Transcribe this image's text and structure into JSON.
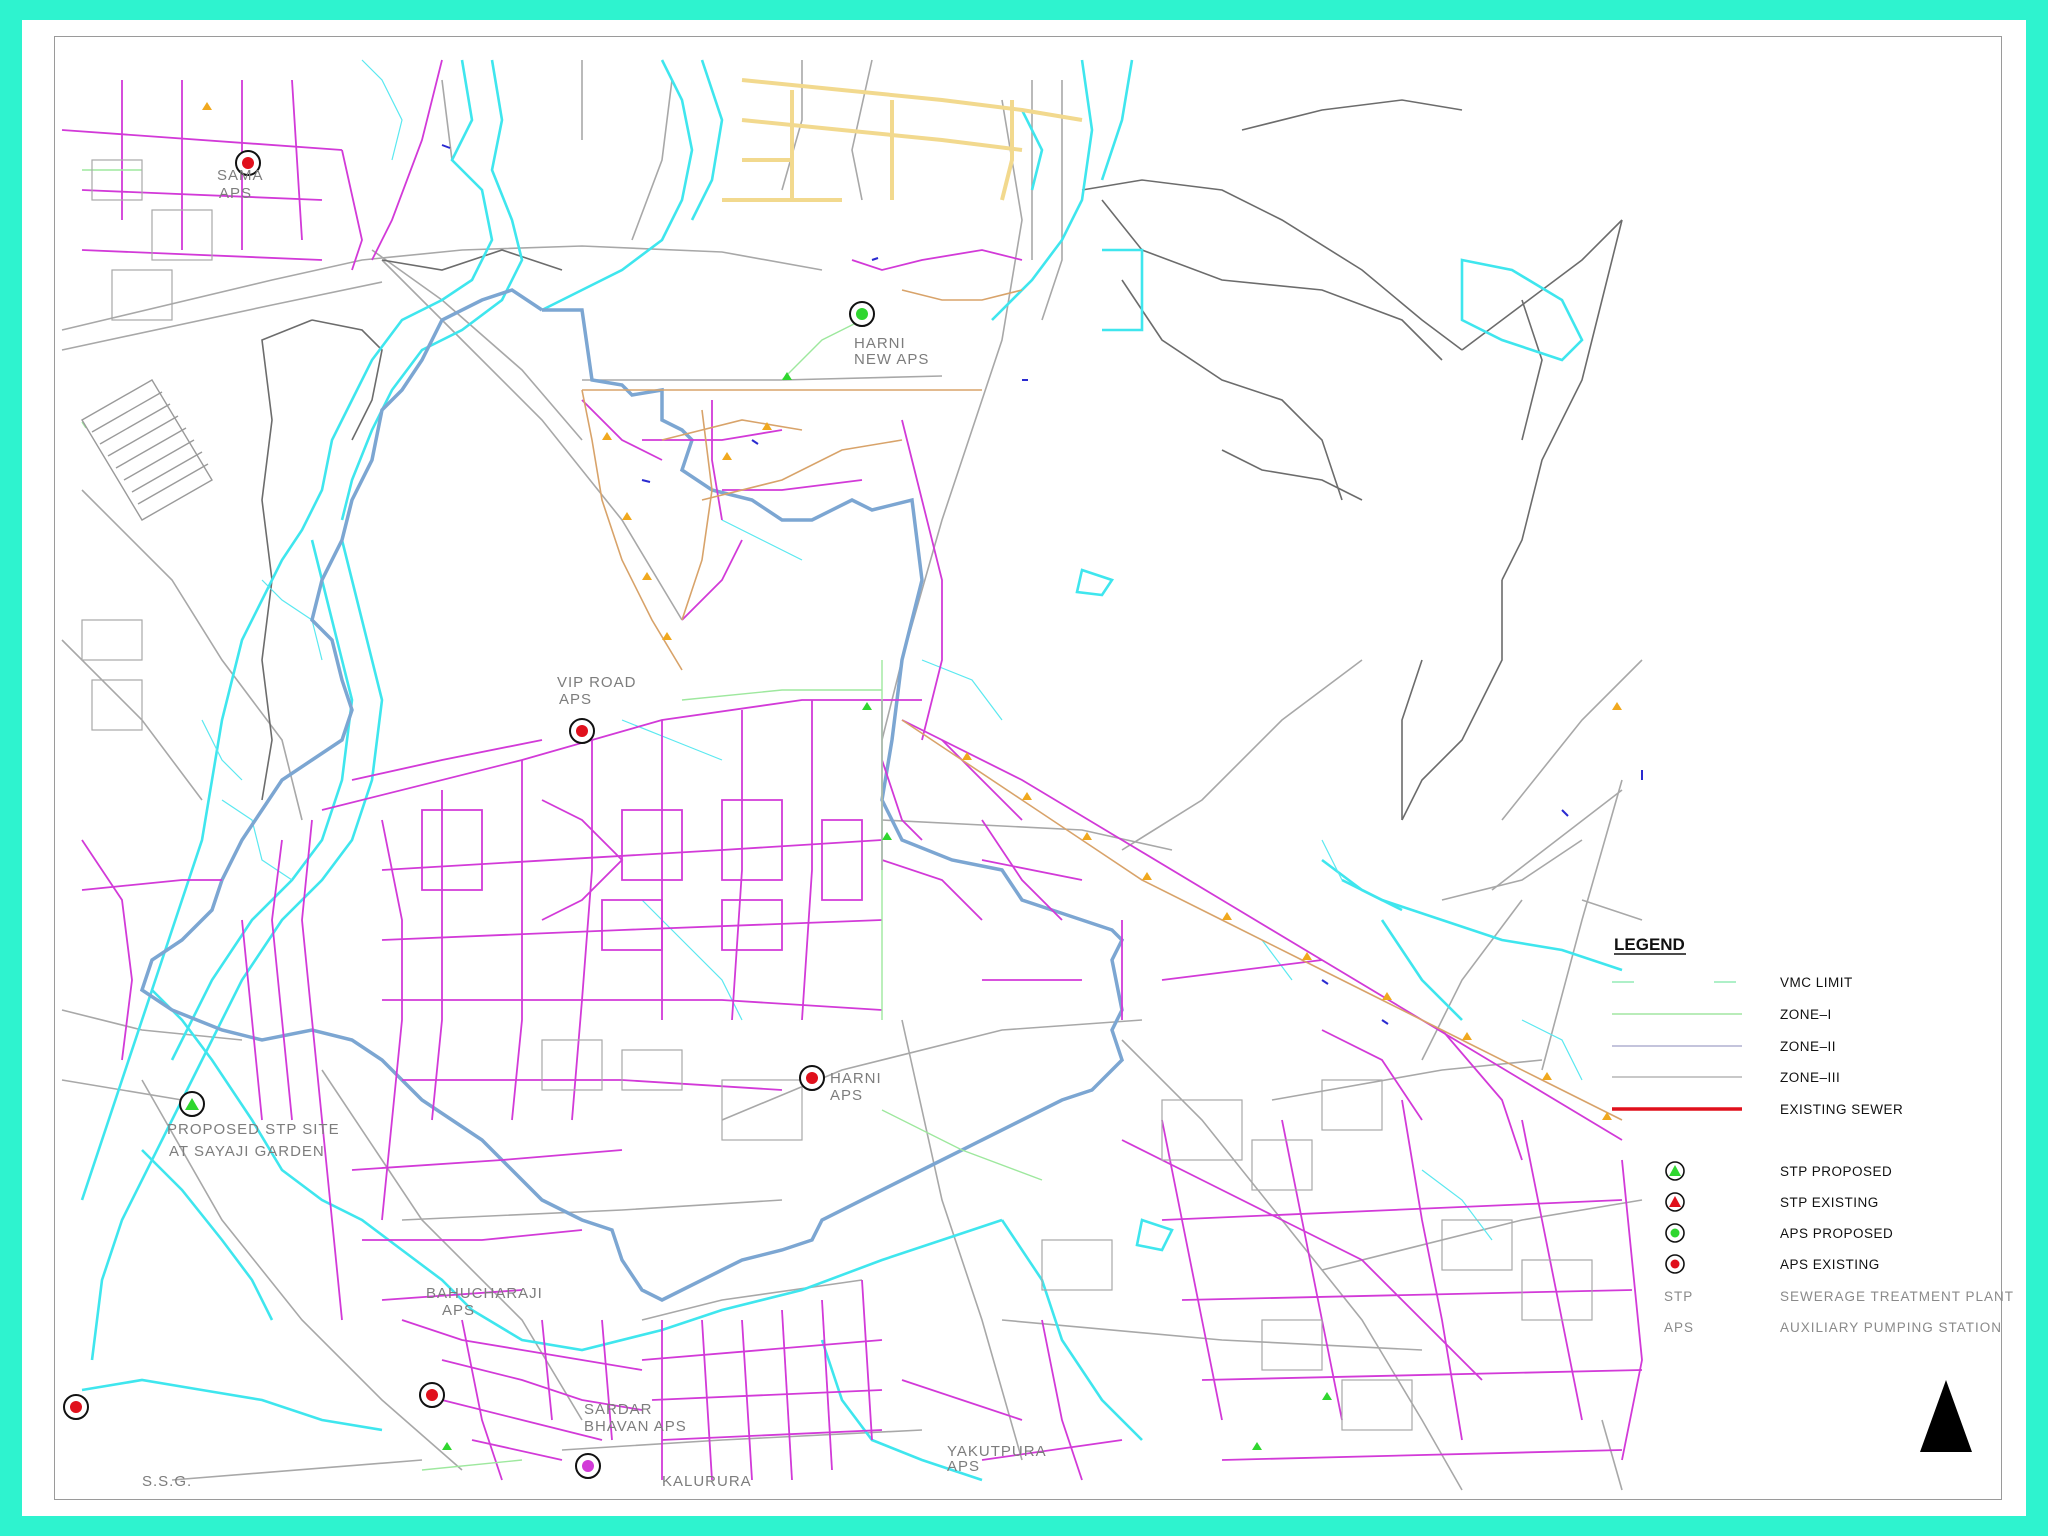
{
  "labels": {
    "sama": [
      "SAMA",
      "APS"
    ],
    "harni_new": [
      "HARNI",
      "NEW APS"
    ],
    "vip_road": [
      "VIP ROAD",
      "APS"
    ],
    "harni": [
      "HARNI",
      "APS"
    ],
    "stp_site": [
      "PROPOSED STP SITE",
      "AT SAYAJI GARDEN"
    ],
    "bahucharaji": [
      "BAHUCHARAJI",
      "APS"
    ],
    "sardar": [
      "SARDAR",
      "BHAVAN APS"
    ],
    "yakutpura": [
      "YAKUTPURA",
      "APS"
    ],
    "ssg": "S.S.G.",
    "kalurura": "KALURURA"
  },
  "legend": {
    "title": "LEGEND",
    "lines": [
      {
        "label": "VMC  LIMIT",
        "color": "#7ee8a8"
      },
      {
        "label": "ZONE–I",
        "color": "#8fe08f"
      },
      {
        "label": "ZONE–II",
        "color": "#a0a0c8"
      },
      {
        "label": "ZONE–III",
        "color": "#a8a8a8"
      },
      {
        "label": "EXISTING  SEWER",
        "color": "#e0101c"
      }
    ],
    "symbols": [
      {
        "label": "STP  PROPOSED",
        "icon": "green-triangle-icon"
      },
      {
        "label": "STP  EXISTING",
        "icon": "red-triangle-icon"
      },
      {
        "label": "APS  PROPOSED",
        "icon": "green-dot-icon"
      },
      {
        "label": "APS  EXISTING",
        "icon": "red-dot-icon"
      }
    ],
    "abbreviations": [
      {
        "abbr": "STP",
        "full": "SEWERAGE  TREATMENT  PLANT"
      },
      {
        "abbr": "APS",
        "full": "AUXILIARY  PUMPING  STATION"
      }
    ]
  },
  "colors": {
    "frame": "#2ef3cf",
    "river": "#3fe6ee",
    "boundary": "#7ca6d2",
    "sewer": "#d23ad8",
    "roads": "#9a9a9a",
    "existing_aps": "#e0101c",
    "proposed": "#2fd62f"
  }
}
